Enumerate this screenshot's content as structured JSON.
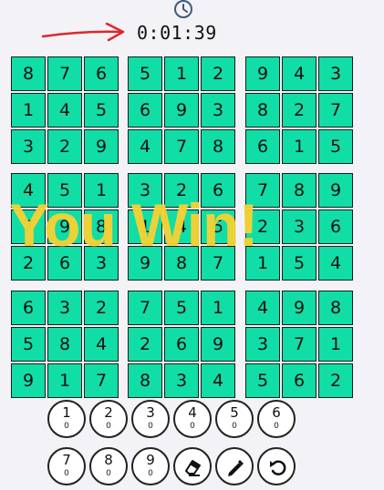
{
  "timer": {
    "value": "0:01:39",
    "icon": "clock-icon"
  },
  "annotation": {
    "arrow_color": "#e0262b"
  },
  "board": {
    "cell_color": "#11dda6",
    "rows": [
      [
        "8",
        "7",
        "6",
        "5",
        "1",
        "2",
        "9",
        "4",
        "3"
      ],
      [
        "1",
        "4",
        "5",
        "6",
        "9",
        "3",
        "8",
        "2",
        "7"
      ],
      [
        "3",
        "2",
        "9",
        "4",
        "7",
        "8",
        "6",
        "1",
        "5"
      ],
      [
        "4",
        "5",
        "1",
        "3",
        "2",
        "6",
        "7",
        "8",
        "9"
      ],
      [
        "7",
        "9",
        "8",
        "1",
        "4",
        "5",
        "2",
        "3",
        "6"
      ],
      [
        "2",
        "6",
        "3",
        "9",
        "8",
        "7",
        "1",
        "5",
        "4"
      ],
      [
        "6",
        "3",
        "2",
        "7",
        "5",
        "1",
        "4",
        "9",
        "8"
      ],
      [
        "5",
        "8",
        "4",
        "2",
        "6",
        "9",
        "3",
        "7",
        "1"
      ],
      [
        "9",
        "1",
        "7",
        "8",
        "3",
        "4",
        "5",
        "6",
        "2"
      ]
    ]
  },
  "overlay": {
    "message": "You Win!",
    "color": "#f8d233"
  },
  "numpad": {
    "numbers": [
      {
        "label": "1",
        "count": "0"
      },
      {
        "label": "2",
        "count": "0"
      },
      {
        "label": "3",
        "count": "0"
      },
      {
        "label": "4",
        "count": "0"
      },
      {
        "label": "5",
        "count": "0"
      },
      {
        "label": "6",
        "count": "0"
      },
      {
        "label": "7",
        "count": "0"
      },
      {
        "label": "8",
        "count": "0"
      },
      {
        "label": "9",
        "count": "0"
      }
    ],
    "tools": [
      "eraser-icon",
      "pencil-icon",
      "undo-icon"
    ]
  }
}
